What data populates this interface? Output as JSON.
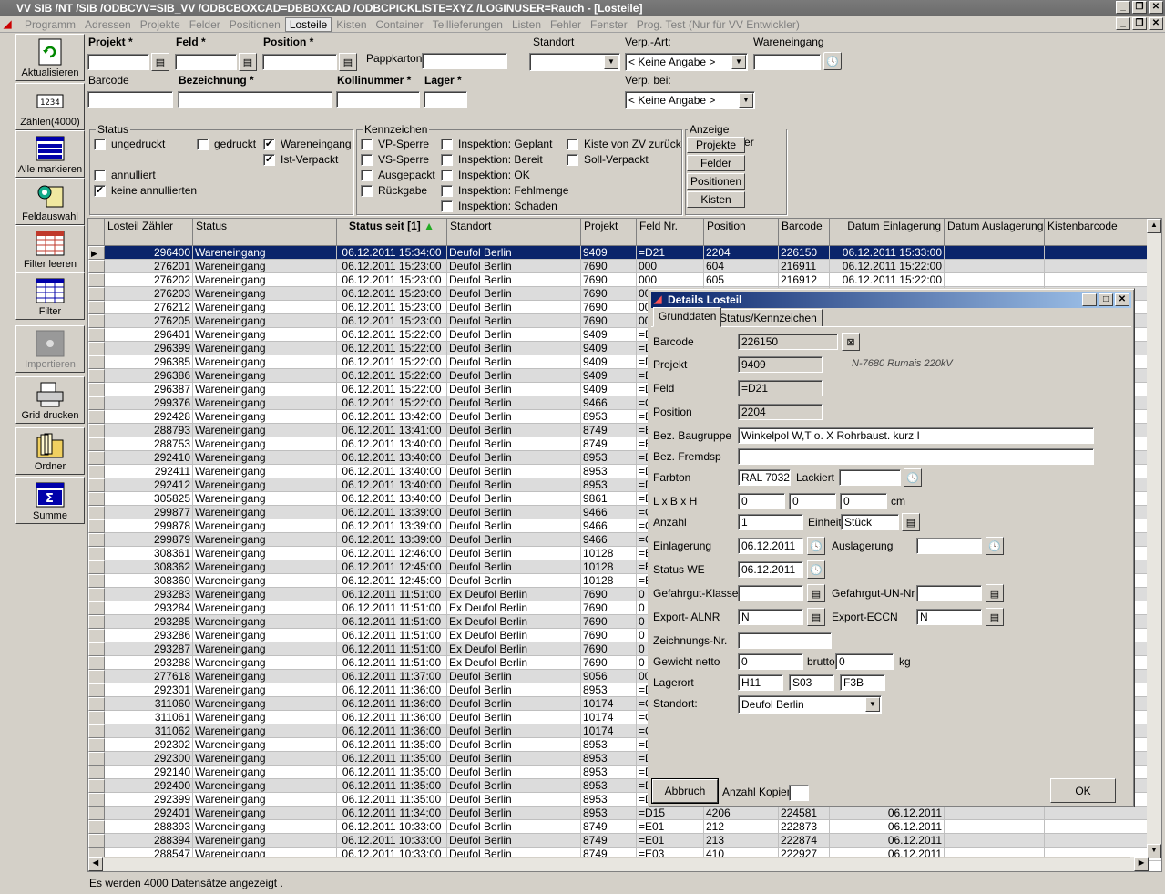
{
  "window": {
    "title": "VV SIB /NT /SIB /ODBCVV=SIB_VV /ODBCBOXCAD=DBBOXCAD /ODBCPICKLISTE=XYZ /LOGINUSER=Rauch - [Losteile]"
  },
  "menu": [
    "Programm",
    "Adressen",
    "Projekte",
    "Felder",
    "Positionen",
    "Losteile",
    "Kisten",
    "Container",
    "Teillieferungen",
    "Listen",
    "Fehler",
    "Fenster",
    "Prog. Test (Nur für VV Entwickler)"
  ],
  "toolbar": {
    "refresh": "Aktualisieren",
    "count": "Zählen(4000)",
    "mark_all": "Alle markieren",
    "field_select": "Feldauswahl",
    "filter_clear": "Filter leeren",
    "filter": "Filter",
    "import": "Importieren",
    "grid_print": "Grid drucken",
    "folder": "Ordner",
    "sum": "Summe"
  },
  "filter": {
    "projekt": "Projekt *",
    "feld": "Feld *",
    "position": "Position *",
    "pappkarton": "Pappkarton",
    "standort": "Standort",
    "verp_art": "Verp.-Art:",
    "verp_art_value": "< Keine Angabe >",
    "wareneingang": "Wareneingang",
    "barcode": "Barcode",
    "bezeichnung": "Bezeichnung *",
    "kollinummer": "Kollinummer *",
    "lager": "Lager *",
    "verp_bei": "Verp. bei:",
    "verp_bei_value": "< Keine Angabe >"
  },
  "status": {
    "title": "Status",
    "ungedruckt": "ungedruckt",
    "gedruckt": "gedruckt",
    "wareneingang": "Wareneingang",
    "ist_verpackt": "Ist-Verpackt",
    "annulliert": "annulliert",
    "keine_annullierten": "keine annullierten"
  },
  "kennzeichen": {
    "title": "Kennzeichen",
    "vp_sperre": "VP-Sperre",
    "vs_sperre": "VS-Sperre",
    "ausgepackt": "Ausgepackt",
    "rueckgabe": "Rückgabe",
    "insp_geplant": "Inspektion: Geplant",
    "insp_bereit": "Inspektion: Bereit",
    "insp_ok": "Inspektion: OK",
    "insp_fehlmenge": "Inspektion: Fehlmenge",
    "insp_schaden": "Inspektion: Schaden",
    "kiste_zv": "Kiste von ZV zurück",
    "soll_verpackt": "Soll-Verpackt"
  },
  "anzeige": {
    "title": "Anzeige zugeordneter",
    "projekte": "Projekte",
    "felder": "Felder",
    "positionen": "Positionen",
    "kisten": "Kisten"
  },
  "grid": {
    "headers": [
      "Losteil Zähler",
      "Status",
      "Status seit [1]",
      "Standort",
      "Projekt",
      "Feld Nr.",
      "Position",
      "Barcode",
      "Datum Einlagerung",
      "Datum Auslagerung",
      "Kistenbarcode",
      "Dat"
    ],
    "rows": [
      [
        "296400",
        "Wareneingang",
        "06.12.2011 15:34:00",
        "Deufol Berlin",
        "9409",
        "=D21",
        "2204",
        "226150",
        "06.12.2011 15:33:00",
        "",
        "",
        "06.12."
      ],
      [
        "276201",
        "Wareneingang",
        "06.12.2011 15:23:00",
        "Deufol Berlin",
        "7690",
        "000",
        "604",
        "216911",
        "06.12.2011 15:22:00",
        "",
        "",
        "06.12."
      ],
      [
        "276202",
        "Wareneingang",
        "06.12.2011 15:23:00",
        "Deufol Berlin",
        "7690",
        "000",
        "605",
        "216912",
        "06.12.2011 15:22:00",
        "",
        "",
        "06.12."
      ],
      [
        "276203",
        "Wareneingang",
        "06.12.2011 15:23:00",
        "Deufol Berlin",
        "7690",
        "000",
        "701",
        "",
        "",
        "",
        "",
        "12."
      ],
      [
        "276212",
        "Wareneingang",
        "06.12.2011 15:23:00",
        "Deufol Berlin",
        "7690",
        "000",
        "903",
        "",
        "",
        "",
        "",
        "12."
      ],
      [
        "276205",
        "Wareneingang",
        "06.12.2011 15:23:00",
        "Deufol Berlin",
        "7690",
        "000",
        "703",
        "",
        "",
        "",
        "",
        "12."
      ],
      [
        "296401",
        "Wareneingang",
        "06.12.2011 15:22:00",
        "Deufol Berlin",
        "9409",
        "=D21",
        "2205",
        "",
        "",
        "",
        "",
        "12."
      ],
      [
        "296399",
        "Wareneingang",
        "06.12.2011 15:22:00",
        "Deufol Berlin",
        "9409",
        "=D21",
        "2203",
        "",
        "",
        "",
        "",
        "12."
      ],
      [
        "296385",
        "Wareneingang",
        "06.12.2011 15:22:00",
        "Deufol Berlin",
        "9409",
        "=D20",
        "2103",
        "",
        "",
        "",
        "",
        "12."
      ],
      [
        "296386",
        "Wareneingang",
        "06.12.2011 15:22:00",
        "Deufol Berlin",
        "9409",
        "=D20",
        "2104",
        "",
        "",
        "",
        "",
        "12."
      ],
      [
        "296387",
        "Wareneingang",
        "06.12.2011 15:22:00",
        "Deufol Berlin",
        "9409",
        "=D20",
        "2105",
        "",
        "",
        "",
        "",
        "12."
      ],
      [
        "299376",
        "Wareneingang",
        "06.12.2011 15:22:00",
        "Deufol Berlin",
        "9466",
        "=C07",
        "1004",
        "",
        "",
        "",
        "",
        "12."
      ],
      [
        "292428",
        "Wareneingang",
        "06.12.2011 13:42:00",
        "Deufol Berlin",
        "8953",
        "=D18",
        "4401",
        "",
        "",
        "",
        "",
        "12."
      ],
      [
        "288793",
        "Wareneingang",
        "06.12.2011 13:41:00",
        "Deufol Berlin",
        "8749",
        "=E15",
        "1704",
        "",
        "",
        "",
        "",
        "12."
      ],
      [
        "288753",
        "Wareneingang",
        "06.12.2011 13:40:00",
        "Deufol Berlin",
        "8749",
        "=E13",
        "1503",
        "",
        "",
        "",
        "",
        "12."
      ],
      [
        "292410",
        "Wareneingang",
        "06.12.2011 13:40:00",
        "Deufol Berlin",
        "8953",
        "=D15",
        "4215",
        "",
        "",
        "",
        "",
        "12."
      ],
      [
        "292411",
        "Wareneingang",
        "06.12.2011 13:40:00",
        "Deufol Berlin",
        "8953",
        "=D15",
        "4216",
        "",
        "",
        "",
        "",
        "12."
      ],
      [
        "292412",
        "Wareneingang",
        "06.12.2011 13:40:00",
        "Deufol Berlin",
        "8953",
        "=D15",
        "4217",
        "",
        "",
        "",
        "",
        "12."
      ],
      [
        "305825",
        "Wareneingang",
        "06.12.2011 13:40:00",
        "Deufol Berlin",
        "9861",
        "=D09",
        "1602",
        "",
        "",
        "",
        "",
        "12."
      ],
      [
        "299877",
        "Wareneingang",
        "06.12.2011 13:39:00",
        "Deufol Berlin",
        "9466",
        "=C19",
        "3417",
        "",
        "",
        "",
        "",
        "12."
      ],
      [
        "299878",
        "Wareneingang",
        "06.12.2011 13:39:00",
        "Deufol Berlin",
        "9466",
        "=C19",
        "3418",
        "",
        "",
        "",
        "",
        "12."
      ],
      [
        "299879",
        "Wareneingang",
        "06.12.2011 13:39:00",
        "Deufol Berlin",
        "9466",
        "=C19",
        "3419",
        "",
        "",
        "",
        "",
        "12."
      ],
      [
        "308361",
        "Wareneingang",
        "06.12.2011 12:46:00",
        "Deufol Berlin",
        "10128",
        "=E05",
        "604",
        "",
        "",
        "",
        "",
        "12."
      ],
      [
        "308362",
        "Wareneingang",
        "06.12.2011 12:45:00",
        "Deufol Berlin",
        "10128",
        "=E05",
        "605",
        "",
        "",
        "",
        "",
        "12."
      ],
      [
        "308360",
        "Wareneingang",
        "06.12.2011 12:45:00",
        "Deufol Berlin",
        "10128",
        "=E05",
        "603",
        "",
        "",
        "",
        "",
        "12."
      ],
      [
        "293283",
        "Wareneingang",
        "06.12.2011 11:51:00",
        "Ex Deufol Berlin",
        "7690",
        "0",
        "9007",
        "",
        "",
        "",
        "",
        "09."
      ],
      [
        "293284",
        "Wareneingang",
        "06.12.2011 11:51:00",
        "Ex Deufol Berlin",
        "7690",
        "0",
        "9006",
        "",
        "",
        "",
        "",
        "09."
      ],
      [
        "293285",
        "Wareneingang",
        "06.12.2011 11:51:00",
        "Ex Deufol Berlin",
        "7690",
        "0",
        "9006",
        "",
        "",
        "",
        "",
        "09."
      ],
      [
        "293286",
        "Wareneingang",
        "06.12.2011 11:51:00",
        "Ex Deufol Berlin",
        "7690",
        "0",
        "9006",
        "",
        "",
        "",
        "",
        "09."
      ],
      [
        "293287",
        "Wareneingang",
        "06.12.2011 11:51:00",
        "Ex Deufol Berlin",
        "7690",
        "0",
        "9006",
        "",
        "",
        "",
        "",
        "09."
      ],
      [
        "293288",
        "Wareneingang",
        "06.12.2011 11:51:00",
        "Ex Deufol Berlin",
        "7690",
        "0",
        "9006",
        "",
        "",
        "",
        "",
        "09."
      ],
      [
        "277618",
        "Wareneingang",
        "06.12.2011 11:37:00",
        "Deufol Berlin",
        "9056",
        "00AED08",
        "1601",
        "",
        "",
        "",
        "",
        ""
      ],
      [
        "292301",
        "Wareneingang",
        "06.12.2011 11:36:00",
        "Deufol Berlin",
        "8953",
        "=D14",
        "3211",
        "",
        "",
        "",
        "",
        ""
      ],
      [
        "311060",
        "Wareneingang",
        "06.12.2011 11:36:00",
        "Deufol Berlin",
        "10174",
        "=C09",
        "905",
        "",
        "",
        "",
        "",
        ""
      ],
      [
        "311061",
        "Wareneingang",
        "06.12.2011 11:36:00",
        "Deufol Berlin",
        "10174",
        "=C09",
        "906",
        "",
        "",
        "",
        "",
        ""
      ],
      [
        "311062",
        "Wareneingang",
        "06.12.2011 11:36:00",
        "Deufol Berlin",
        "10174",
        "=C09",
        "907",
        "",
        "",
        "",
        "",
        ""
      ],
      [
        "292302",
        "Wareneingang",
        "06.12.2011 11:35:00",
        "Deufol Berlin",
        "8953",
        "=D14",
        "3212",
        "",
        "",
        "",
        "",
        ""
      ],
      [
        "292300",
        "Wareneingang",
        "06.12.2011 11:35:00",
        "Deufol Berlin",
        "8953",
        "=D14",
        "3210",
        "",
        "",
        "",
        "",
        ""
      ],
      [
        "292140",
        "Wareneingang",
        "06.12.2011 11:35:00",
        "Deufol Berlin",
        "8953",
        "=D09.B",
        "2007",
        "",
        "",
        "",
        "",
        ""
      ],
      [
        "292400",
        "Wareneingang",
        "06.12.2011 11:35:00",
        "Deufol Berlin",
        "8953",
        "=D15",
        "4205",
        "",
        "",
        "",
        "",
        ""
      ],
      [
        "292399",
        "Wareneingang",
        "06.12.2011 11:35:00",
        "Deufol Berlin",
        "8953",
        "=D15",
        "4207",
        "",
        "",
        "",
        "",
        ""
      ],
      [
        "292401",
        "Wareneingang",
        "06.12.2011 11:34:00",
        "Deufol Berlin",
        "8953",
        "=D15",
        "4206",
        "224581",
        "06.12.2011",
        "",
        "",
        ""
      ],
      [
        "288393",
        "Wareneingang",
        "06.12.2011 10:33:00",
        "Deufol Berlin",
        "8749",
        "=E01",
        "212",
        "222873",
        "06.12.2011",
        "",
        "",
        ""
      ],
      [
        "288394",
        "Wareneingang",
        "06.12.2011 10:33:00",
        "Deufol Berlin",
        "8749",
        "=E01",
        "213",
        "222874",
        "06.12.2011",
        "",
        "",
        ""
      ],
      [
        "288547",
        "Wareneingang",
        "06.12.2011 10:33:00",
        "Deufol Berlin",
        "8749",
        "=E03",
        "410",
        "222927",
        "06.12.2011",
        "",
        "",
        ""
      ]
    ]
  },
  "statusbar": "Es werden 4000 Datensätze angezeigt .",
  "dialog": {
    "title": "Details Losteil",
    "tab1": "Grunddaten",
    "tab2": "Status/Kennzeichen",
    "barcode_lbl": "Barcode",
    "barcode": "226150",
    "projekt_lbl": "Projekt",
    "projekt": "9409",
    "projekt_desc": "N-7680 Rumais 220kV",
    "feld_lbl": "Feld",
    "feld": "=D21",
    "position_lbl": "Position",
    "position": "2204",
    "baugruppe_lbl": "Bez. Baugruppe",
    "baugruppe": "Winkelpol W,T o. X Rohrbaust. kurz I",
    "fremdsp_lbl": "Bez. Fremdsp",
    "fremdsp": "",
    "farbton_lbl": "Farbton",
    "farbton": "RAL 7032",
    "lackiert_lbl": "Lackiert",
    "lackiert": "",
    "lbh_lbl": "L x B x H",
    "l": "0",
    "b": "0",
    "h": "0",
    "cm": "cm",
    "anzahl_lbl": "Anzahl",
    "anzahl": "1",
    "einheit_lbl": "Einheit",
    "einheit": "Stück",
    "einlagerung_lbl": "Einlagerung",
    "einlagerung": "06.12.2011",
    "auslagerung_lbl": "Auslagerung",
    "auslagerung": "",
    "status_we_lbl": "Status WE",
    "status_we": "06.12.2011",
    "gefahrgut_kl_lbl": "Gefahrgut-Klasse",
    "gefahrgut_kl": "",
    "gefahrgut_un_lbl": "Gefahrgut-UN-Nr",
    "gefahrgut_un": "",
    "export_alnr_lbl": "Export- ALNR",
    "export_alnr": "N",
    "export_eccn_lbl": "Export-ECCN",
    "export_eccn": "N",
    "zeichnung_lbl": "Zeichnungs-Nr.",
    "zeichnung": "",
    "gewicht_lbl": "Gewicht netto",
    "gewicht_netto": "0",
    "brutto_lbl": "brutto",
    "brutto": "0",
    "kg": "kg",
    "lagerort_lbl": "Lagerort",
    "lager1": "H11",
    "lager2": "S03",
    "lager3": "F3B",
    "standort_lbl": "Standort:",
    "standort": "Deufol Berlin",
    "abbruch": "Abbruch",
    "kopien_lbl": "Anzahl Kopien:",
    "kopien": "",
    "ok": "OK"
  },
  "colors": {
    "selection": "#0a246a",
    "title_active": "#0a246a",
    "face": "#d4d0c8"
  }
}
